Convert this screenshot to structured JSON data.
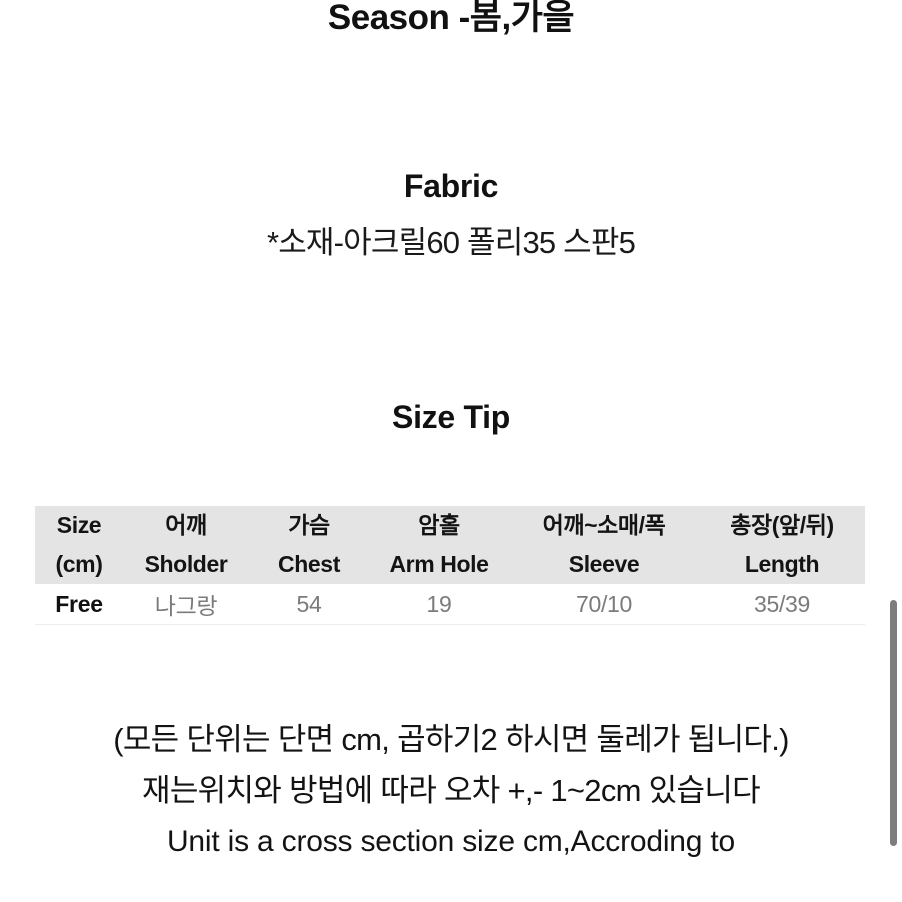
{
  "page": {
    "background_color": "#ffffff",
    "text_color": "#111111"
  },
  "season": {
    "title": "Season -봄,가을"
  },
  "fabric": {
    "heading": "Fabric",
    "detail": "*소재-아크릴60 폴리35 스판5"
  },
  "size_tip": {
    "heading": "Size Tip",
    "table": {
      "header_background": "#e4e4e4",
      "columns": [
        {
          "korean": "Size",
          "english": "(cm)"
        },
        {
          "korean": "어깨",
          "english": "Sholder"
        },
        {
          "korean": "가슴",
          "english": "Chest"
        },
        {
          "korean": "암홀",
          "english": "Arm Hole"
        },
        {
          "korean": "어깨~소매/폭",
          "english": "Sleeve"
        },
        {
          "korean": "총장(앞/뒤)",
          "english": "Length"
        }
      ],
      "rows": [
        {
          "size": "Free",
          "sholder": "나그랑",
          "chest": "54",
          "arm_hole": "19",
          "sleeve": "70/10",
          "length": "35/39"
        }
      ]
    }
  },
  "notes": {
    "lines": [
      "(모든 단위는 단면 cm, 곱하기2 하시면 둘레가 됩니다.)",
      "재는위치와 방법에 따라 오차 +,- 1~2cm 있습니다",
      "Unit is a cross section size cm,Accroding to"
    ]
  },
  "scrollbar": {
    "thumb_color": "#7d7d7d"
  }
}
